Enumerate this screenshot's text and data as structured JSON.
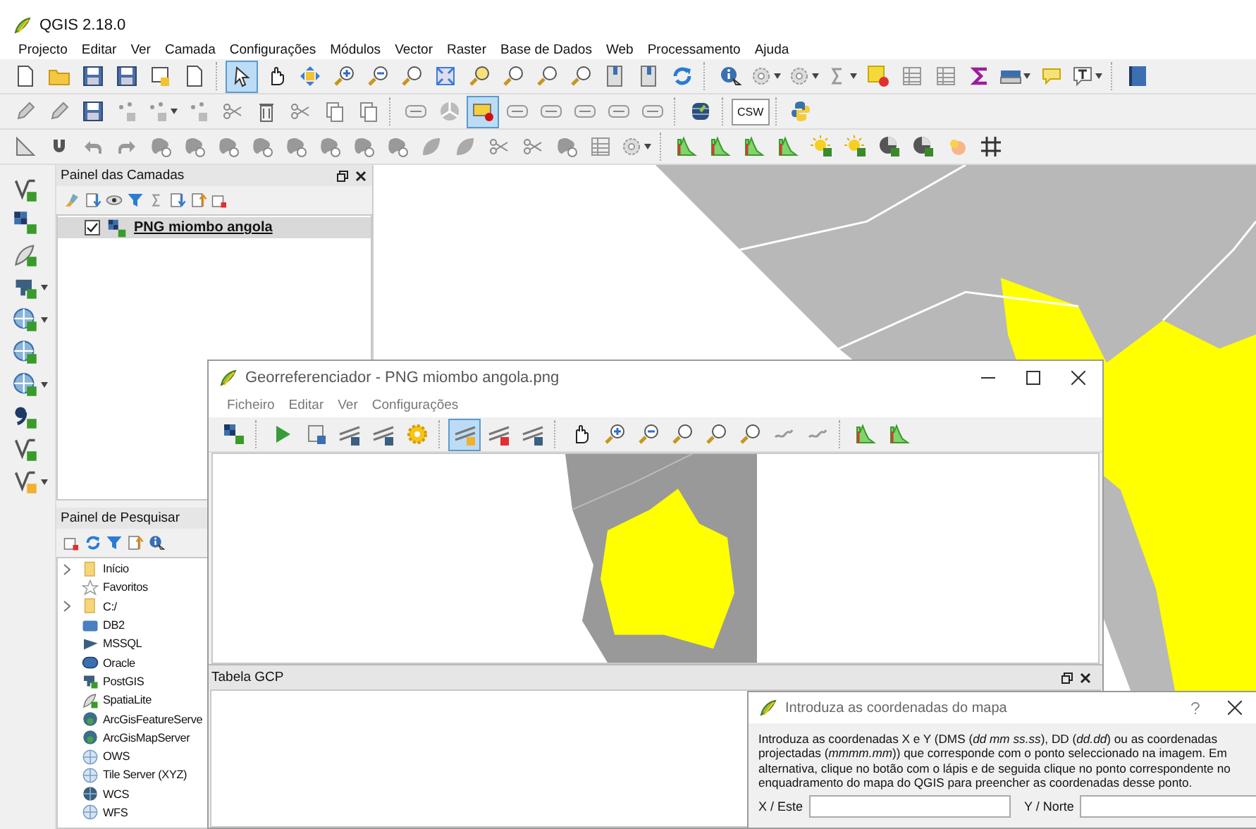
{
  "window": {
    "title": "QGIS 2.18.0"
  },
  "menu": [
    "Projecto",
    "Editar",
    "Ver",
    "Camada",
    "Configurações",
    "Módulos",
    "Vector",
    "Raster",
    "Base de Dados",
    "Web",
    "Processamento",
    "Ajuda"
  ],
  "toolbars": [
    {
      "tools": [
        {
          "selected": false
        },
        {
          "selected": false
        },
        {
          "selected": false
        },
        {
          "selected": false
        },
        {
          "selected": false
        },
        {
          "selected": false
        },
        {
          "selected": true
        },
        {
          "selected": false
        },
        {
          "selected": false
        },
        {
          "selected": false
        },
        {
          "selected": false
        },
        {
          "selected": false
        },
        {
          "selected": false
        },
        {
          "selected": false
        },
        {
          "selected": false
        },
        {
          "selected": false
        },
        {
          "selected": false
        },
        {
          "selected": false
        },
        {
          "selected": false
        },
        {
          "selected": false
        },
        {
          "selected": false
        },
        {
          "selected": false
        },
        {
          "selected": false
        },
        {
          "selected": false
        },
        {
          "selected": false
        },
        {
          "selected": false
        },
        {
          "selected": false
        },
        {
          "selected": false
        },
        {
          "selected": false
        },
        {
          "selected": false
        },
        {
          "selected": false
        },
        {
          "selected": false
        }
      ]
    },
    {
      "tools": [
        {
          "selected": false
        },
        {
          "selected": false
        },
        {
          "selected": false
        },
        {
          "selected": false
        },
        {
          "selected": false
        },
        {
          "selected": false
        },
        {
          "selected": false
        },
        {
          "selected": false
        },
        {
          "selected": false
        },
        {
          "selected": false
        },
        {
          "selected": false
        },
        {
          "selected": false
        },
        {
          "selected": false
        },
        {
          "selected": true
        },
        {
          "selected": false
        },
        {
          "selected": false
        },
        {
          "selected": false
        },
        {
          "selected": false
        },
        {
          "selected": false
        },
        {
          "selected": false
        },
        {
          "selected": false,
          "label": "CSW"
        },
        {
          "selected": false
        }
      ]
    },
    {
      "tools": [
        {
          "selected": false
        },
        {
          "selected": false
        },
        {
          "selected": false
        },
        {
          "selected": false
        },
        {
          "selected": false
        },
        {
          "selected": false
        },
        {
          "selected": false
        },
        {
          "selected": false
        },
        {
          "selected": false
        },
        {
          "selected": false
        },
        {
          "selected": false
        },
        {
          "selected": false
        },
        {
          "selected": false
        },
        {
          "selected": false
        },
        {
          "selected": false
        },
        {
          "selected": false
        },
        {
          "selected": false
        },
        {
          "selected": false
        },
        {
          "selected": false
        },
        {
          "selected": false
        },
        {
          "selected": false
        },
        {
          "selected": false
        },
        {
          "selected": false
        },
        {
          "selected": false
        },
        {
          "selected": false
        },
        {
          "selected": false
        },
        {
          "selected": false
        },
        {
          "selected": false
        },
        {
          "selected": false
        }
      ]
    }
  ],
  "layers_panel": {
    "title": "Painel das Camadas",
    "layers": [
      {
        "name": "PNG miombo angola",
        "checked": true,
        "selected": true
      }
    ]
  },
  "browser_panel": {
    "title": "Painel de Pesquisar",
    "items": [
      {
        "label": "Início",
        "expandable": true
      },
      {
        "label": "Favoritos",
        "expandable": false
      },
      {
        "label": "C:/",
        "expandable": true
      },
      {
        "label": "DB2",
        "expandable": false
      },
      {
        "label": "MSSQL",
        "expandable": false
      },
      {
        "label": "Oracle",
        "expandable": false
      },
      {
        "label": "PostGIS",
        "expandable": false
      },
      {
        "label": "SpatiaLite",
        "expandable": false
      },
      {
        "label": "ArcGisFeatureServe",
        "expandable": false
      },
      {
        "label": "ArcGisMapServer",
        "expandable": false
      },
      {
        "label": "OWS",
        "expandable": false
      },
      {
        "label": "Tile Server (XYZ)",
        "expandable": false
      },
      {
        "label": "WCS",
        "expandable": false
      },
      {
        "label": "WFS",
        "expandable": false
      }
    ]
  },
  "georeferencer": {
    "title": "Georreferenciador - PNG miombo angola.png",
    "menu": [
      "Ficheiro",
      "Editar",
      "Ver",
      "Configurações"
    ],
    "tools": [
      {
        "selected": false
      },
      {
        "selected": false
      },
      {
        "selected": false
      },
      {
        "selected": false
      },
      {
        "selected": false
      },
      {
        "selected": false
      },
      {
        "selected": true
      },
      {
        "selected": false
      },
      {
        "selected": false
      },
      {
        "selected": false
      },
      {
        "selected": false
      },
      {
        "selected": false
      },
      {
        "selected": false
      },
      {
        "selected": false
      },
      {
        "selected": false
      },
      {
        "selected": false
      },
      {
        "selected": false
      },
      {
        "selected": false
      },
      {
        "selected": false
      }
    ],
    "gcp_table": {
      "title": "Tabela GCP"
    }
  },
  "dialog": {
    "title": "Introduza as coordenadas do mapa",
    "text": "Introduza as coordenadas X e Y (DMS (*dd mm ss.ss*), DD (*dd.dd*) ou as coordenadas projectadas (*mmmm.mm*)) que corresponde com o ponto seleccionado na imagem. Em alternativa, clique no botão com o lápis e de seguida clique no ponto correspondente no enquadramento do mapa do QGIS para preencher as coordenadas desse ponto.",
    "fields": [
      {
        "label": "X / Este"
      },
      {
        "label": "Y / Norte"
      }
    ]
  }
}
